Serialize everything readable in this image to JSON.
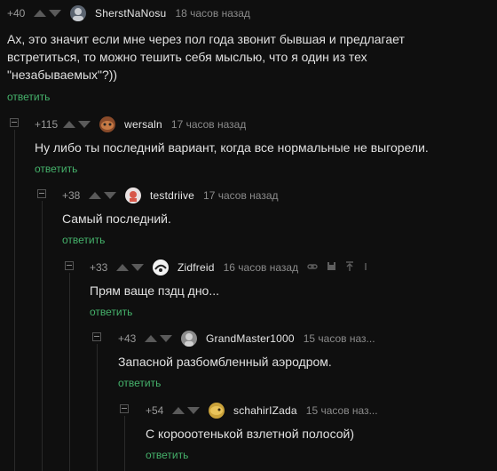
{
  "comments": [
    {
      "rating": "+40",
      "author": "SherstNaNosu",
      "time": "18 часов назад",
      "text_lines": [
        "Ах, это значит если мне через пол года звонит бывшая и предлагает",
        "встретиться, то можно тешить себя мыслью, что я один из тех",
        "\"незабываемых\"?))"
      ],
      "reply": "ответить"
    },
    {
      "rating": "+115",
      "author": "wersaln",
      "time": "17 часов назад",
      "text_lines": [
        "Ну либо ты последний вариант, когда все нормальные не выгорели."
      ],
      "reply": "ответить"
    },
    {
      "rating": "+38",
      "author": "testdriive",
      "time": "17 часов назад",
      "text_lines": [
        "Самый последний."
      ],
      "reply": "ответить"
    },
    {
      "rating": "+33",
      "author": "Zidfreid",
      "time": "16 часов назад",
      "text_lines": [
        "Прям ваще пздц дно..."
      ],
      "reply": "ответить"
    },
    {
      "rating": "+43",
      "author": "GrandMaster1000",
      "time": "15 часов наз...",
      "text_lines": [
        "Запасной разбомбленный аэродром."
      ],
      "reply": "ответить"
    },
    {
      "rating": "+54",
      "author": "schahirIZada",
      "time": "15 часов наз...",
      "text_lines": [
        "С корооотенькой взлетной полосой)"
      ],
      "reply": "ответить"
    }
  ],
  "colors": {
    "reply_link": "#45b26b",
    "background": "#0f0f0f",
    "arrow": "#5a5a5a"
  },
  "icons": {
    "up": "arrow-up-icon",
    "down": "arrow-down-icon",
    "collapse": "collapse-thread-icon",
    "link": "link-icon",
    "save": "save-icon",
    "top": "scroll-to-parent-icon"
  }
}
